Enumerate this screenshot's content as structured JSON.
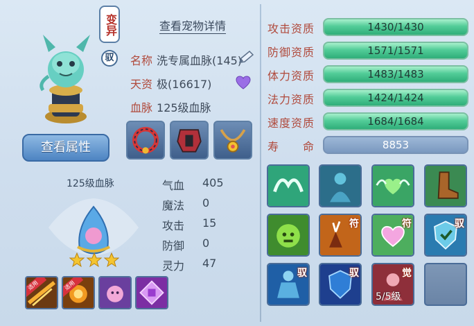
{
  "pet": {
    "variant_badge": "变异",
    "tame_badge": "驭",
    "view_details": "查看宠物详情",
    "name_label": "名称",
    "name_value": "洗专属血脉(145)",
    "talent_label": "天资",
    "talent_value": "极(16617)",
    "bloodline_label": "血脉",
    "bloodline_value": "125级血脉",
    "view_attr_button": "查看属性",
    "bloodline_title": "125级血脉",
    "star_count": 3
  },
  "stats": [
    {
      "label": "气血",
      "value": "405"
    },
    {
      "label": "魔法",
      "value": "0"
    },
    {
      "label": "攻击",
      "value": "15"
    },
    {
      "label": "防御",
      "value": "0"
    },
    {
      "label": "灵力",
      "value": "47"
    }
  ],
  "aptitudes": [
    {
      "label": "攻击资质",
      "value": "1430/1430"
    },
    {
      "label": "防御资质",
      "value": "1571/1571"
    },
    {
      "label": "体力资质",
      "value": "1483/1483"
    },
    {
      "label": "法力资质",
      "value": "1424/1424"
    },
    {
      "label": "速度资质",
      "value": "1684/1684"
    }
  ],
  "lifespan": {
    "label": "寿　　命",
    "value": "8853"
  },
  "small_skill_tags": [
    "适用",
    "适用"
  ],
  "skills": {
    "tag_fu_1": "符",
    "tag_fu_2": "符",
    "tag_yu_1": "驭",
    "tag_yu_2": "驭",
    "tag_yu_3": "驭",
    "tag_jue": "觉",
    "level_text": "5/5级"
  },
  "colors": {
    "accent_red": "#b04a3c",
    "bar_green": "#52cc98",
    "bar_blue": "#7a98bf"
  }
}
